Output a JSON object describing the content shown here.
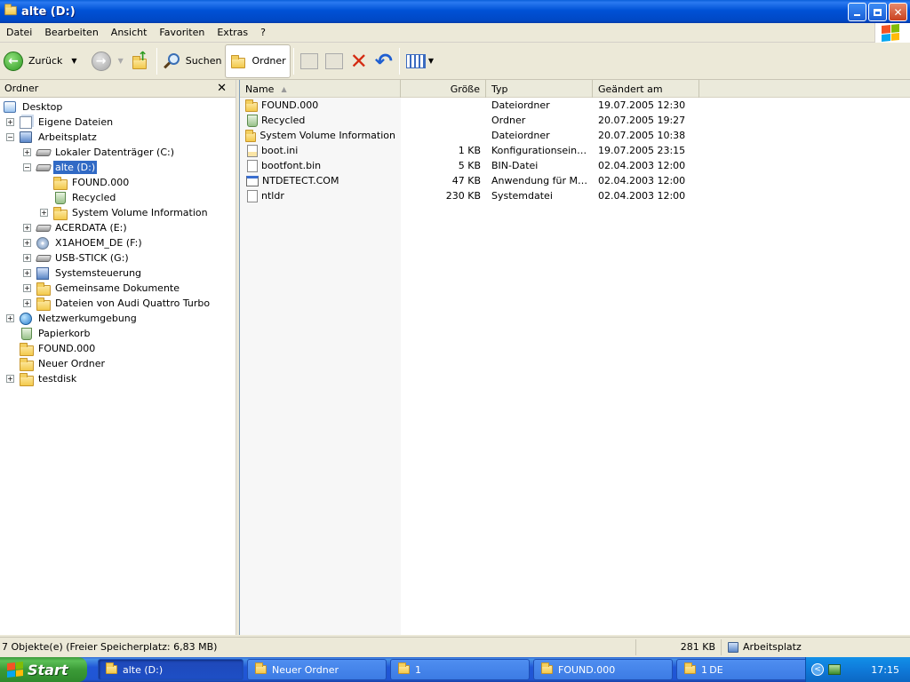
{
  "window": {
    "title": "alte (D:)",
    "buttons": [
      "minimize",
      "maximize",
      "close"
    ]
  },
  "menu": [
    "Datei",
    "Bearbeiten",
    "Ansicht",
    "Favoriten",
    "Extras",
    "?"
  ],
  "toolbar": {
    "back_label": "Zurück",
    "search_label": "Suchen",
    "folders_label": "Ordner"
  },
  "folder_pane": {
    "title": "Ordner",
    "close": "✕",
    "tree": [
      {
        "label": "Desktop",
        "icon": "desktop-icon",
        "expander": ""
      },
      {
        "label": "Eigene Dateien",
        "icon": "my-documents-icon",
        "expander": "+"
      },
      {
        "label": "Arbeitsplatz",
        "icon": "my-computer-icon",
        "expander": "−"
      },
      {
        "label": "Lokaler Datenträger (C:)",
        "icon": "hard-drive-icon",
        "expander": "+"
      },
      {
        "label": "alte (D:)",
        "icon": "hard-drive-icon",
        "expander": "−",
        "selected": true
      },
      {
        "label": "FOUND.000",
        "icon": "folder-icon",
        "expander": ""
      },
      {
        "label": "Recycled",
        "icon": "recycle-bin-icon",
        "expander": ""
      },
      {
        "label": "System Volume Information",
        "icon": "folder-icon",
        "expander": "+"
      },
      {
        "label": "ACERDATA (E:)",
        "icon": "hard-drive-icon",
        "expander": "+"
      },
      {
        "label": "X1AHOEM_DE (F:)",
        "icon": "cd-drive-icon",
        "expander": "+"
      },
      {
        "label": "USB-STICK (G:)",
        "icon": "hard-drive-icon",
        "expander": "+"
      },
      {
        "label": "Systemsteuerung",
        "icon": "control-panel-icon",
        "expander": "+"
      },
      {
        "label": "Gemeinsame Dokumente",
        "icon": "folder-icon",
        "expander": "+"
      },
      {
        "label": "Dateien von Audi Quattro Turbo",
        "icon": "folder-icon",
        "expander": "+"
      },
      {
        "label": "Netzwerkumgebung",
        "icon": "network-icon",
        "expander": "+"
      },
      {
        "label": "Papierkorb",
        "icon": "recycle-bin-icon",
        "expander": ""
      },
      {
        "label": "FOUND.000",
        "icon": "folder-icon",
        "expander": ""
      },
      {
        "label": "Neuer Ordner",
        "icon": "folder-icon",
        "expander": ""
      },
      {
        "label": "testdisk",
        "icon": "folder-icon",
        "expander": "+"
      }
    ]
  },
  "list": {
    "columns": {
      "name": "Name",
      "size": "Größe",
      "type": "Typ",
      "modified": "Geändert am"
    },
    "rows": [
      {
        "name": "FOUND.000",
        "size": "",
        "type": "Dateiordner",
        "modified": "19.07.2005 12:30",
        "icon": "folder-icon"
      },
      {
        "name": "Recycled",
        "size": "",
        "type": "Ordner",
        "modified": "20.07.2005 19:27",
        "icon": "recycle-bin-icon"
      },
      {
        "name": "System Volume Information",
        "size": "",
        "type": "Dateiordner",
        "modified": "20.07.2005 10:38",
        "icon": "folder-icon"
      },
      {
        "name": "boot.ini",
        "size": "1 KB",
        "type": "Konfigurationseinst...",
        "modified": "19.07.2005 23:15",
        "icon": "config-file-icon"
      },
      {
        "name": "bootfont.bin",
        "size": "5 KB",
        "type": "BIN-Datei",
        "modified": "02.04.2003 12:00",
        "icon": "file-icon"
      },
      {
        "name": "NTDETECT.COM",
        "size": "47 KB",
        "type": "Anwendung für MS-...",
        "modified": "02.04.2003 12:00",
        "icon": "application-icon"
      },
      {
        "name": "ntldr",
        "size": "230 KB",
        "type": "Systemdatei",
        "modified": "02.04.2003 12:00",
        "icon": "file-icon"
      }
    ]
  },
  "status": {
    "objects": "7 Objekte(e) (Freier Speicherplatz: 6,83 MB)",
    "size": "281 KB",
    "location": "Arbeitsplatz"
  },
  "taskbar": {
    "start_label": "Start",
    "tasks": [
      {
        "label": "alte (D:)",
        "active": true
      },
      {
        "label": "Neuer Ordner",
        "active": false
      },
      {
        "label": "1",
        "active": false
      },
      {
        "label": "FOUND.000",
        "active": false
      },
      {
        "label": "1",
        "active": false
      }
    ],
    "language": "DE",
    "clock": "17:15"
  }
}
